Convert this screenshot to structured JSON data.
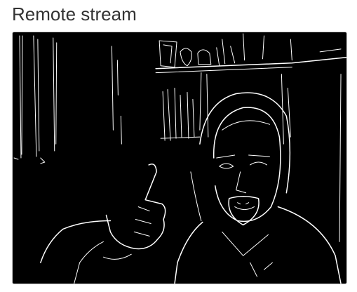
{
  "heading": {
    "title": "Remote stream"
  },
  "video": {
    "icon": "video-stream",
    "filter": "edge-detection",
    "colors": {
      "background": "#000000",
      "edges": "#ffffff"
    }
  }
}
